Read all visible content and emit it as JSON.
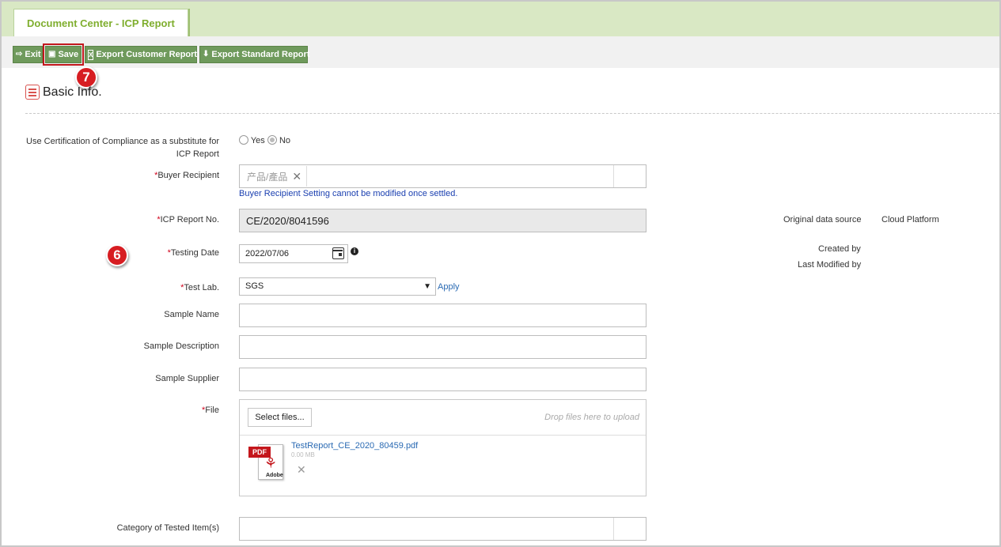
{
  "tab": {
    "title": "Document Center - ICP Report"
  },
  "toolbar": {
    "exit_label": "Exit",
    "save_label": "Save",
    "export_customer_label": "Export Customer Report",
    "export_standard_label": "Export Standard Report"
  },
  "callouts": {
    "save": "7",
    "testing_date": "6"
  },
  "section": {
    "title": "Basic Info."
  },
  "form": {
    "coc_label_line1": "Use Certification of Compliance as a substitute for",
    "coc_label_line2": "ICP Report",
    "coc_options": {
      "yes": "Yes",
      "no": "No",
      "selected": "No"
    },
    "required_mark": "*",
    "buyer_recipient_label": "Buyer Recipient",
    "buyer_recipient_tag": "产品/產品",
    "buyer_recipient_hint": "Buyer Recipient Setting cannot be modified once settled.",
    "icp_report_no_label": "ICP Report No.",
    "icp_report_no_value": "CE/2020/8041596",
    "testing_date_label": "Testing Date",
    "testing_date_value": "2022/07/06",
    "test_lab_label": "Test Lab.",
    "test_lab_value": "SGS",
    "apply_label": "Apply",
    "sample_name_label": "Sample Name",
    "sample_description_label": "Sample Description",
    "sample_supplier_label": "Sample Supplier",
    "file_label": "File",
    "select_files_label": "Select files...",
    "drop_hint": "Drop files here to upload",
    "file_name": "TestReport_CE_2020_80459.pdf",
    "file_size": "0.00 MB",
    "pdf_badge": "PDF",
    "pdf_brand": "Adobe",
    "category_label": "Category of Tested Item(s)"
  },
  "meta": {
    "original_source_label": "Original data source",
    "original_source_value": "Cloud Platform",
    "created_by_label": "Created by",
    "last_modified_by_label": "Last Modified by"
  },
  "colors": {
    "accent_green": "#6f9a5c",
    "tab_green": "#7fae2e",
    "required_red": "#d0021b",
    "callout_red": "#d71d22"
  }
}
